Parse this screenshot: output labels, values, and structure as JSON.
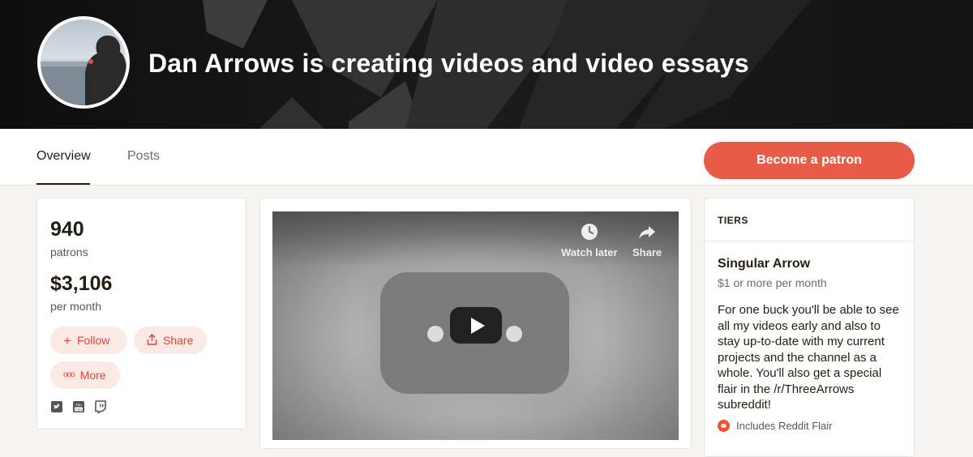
{
  "banner": {
    "title": "Dan Arrows is creating videos and video essays"
  },
  "nav": {
    "tabs": [
      {
        "label": "Overview",
        "active": true
      },
      {
        "label": "Posts",
        "active": false
      }
    ],
    "cta_label": "Become a patron"
  },
  "stats": {
    "patrons_count": "940",
    "patrons_label": "patrons",
    "amount": "$3,106",
    "amount_label": "per month",
    "follow_label": "Follow",
    "share_label": "Share",
    "more_label": "More",
    "social_icons": [
      "twitter-icon",
      "youtube-icon",
      "twitch-icon"
    ]
  },
  "video": {
    "watch_later_label": "Watch later",
    "share_label": "Share"
  },
  "tiers": {
    "heading": "TIERS",
    "items": [
      {
        "name": "Singular Arrow",
        "price": "$1 or more per month",
        "description": "For one buck you'll be able to see all my videos early and also to stay up-to-date with my current projects and the channel as a whole. You'll also get a special flair in the /r/ThreeArrows subreddit!",
        "benefit": "Includes Reddit Flair"
      }
    ]
  },
  "colors": {
    "accent": "#e85b46",
    "pill_bg": "#fbe9e6",
    "banner_bg": "#1a1a1a",
    "reddit": "#f2502a"
  }
}
